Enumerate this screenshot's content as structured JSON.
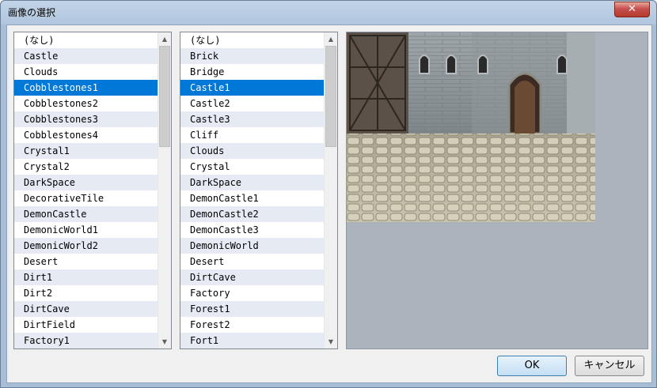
{
  "window": {
    "title": "画像の選択",
    "close_glyph": "✕"
  },
  "left_list": {
    "items": [
      "(なし)",
      "Castle",
      "Clouds",
      "Cobblestones1",
      "Cobblestones2",
      "Cobblestones3",
      "Cobblestones4",
      "Crystal1",
      "Crystal2",
      "DarkSpace",
      "DecorativeTile",
      "DemonCastle",
      "DemonicWorld1",
      "DemonicWorld2",
      "Desert",
      "Dirt1",
      "Dirt2",
      "DirtCave",
      "DirtField",
      "Factory1"
    ],
    "selected_index": 3
  },
  "right_list": {
    "items": [
      "(なし)",
      "Brick",
      "Bridge",
      "Castle1",
      "Castle2",
      "Castle3",
      "Cliff",
      "Clouds",
      "Crystal",
      "DarkSpace",
      "DemonCastle1",
      "DemonCastle2",
      "DemonCastle3",
      "DemonicWorld",
      "Desert",
      "DirtCave",
      "Factory",
      "Forest1",
      "Forest2",
      "Fort1"
    ],
    "selected_index": 3
  },
  "scrollbar": {
    "up_glyph": "▲",
    "down_glyph": "▼"
  },
  "buttons": {
    "ok_label": "OK",
    "cancel_label": "キャンセル"
  },
  "colors": {
    "selection": "#0078d7",
    "alt_row": "#e6ebf3",
    "preview_background": "#abb3bd"
  },
  "preview": {
    "description_icon": "castle-courtyard-image"
  }
}
